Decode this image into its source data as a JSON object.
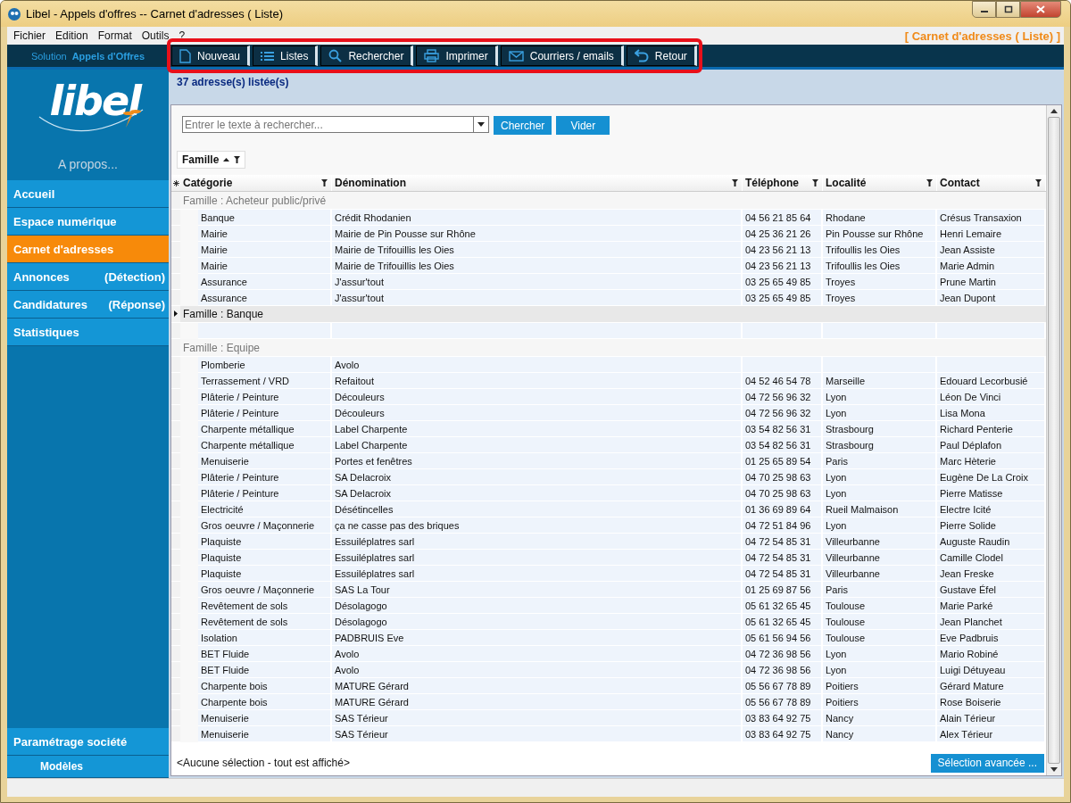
{
  "window": {
    "title": "Libel - Appels d'offres -- Carnet d'adresses ( Liste)"
  },
  "menu": [
    "Fichier",
    "Edition",
    "Format",
    "Outils",
    "?"
  ],
  "screen_label": "[ Carnet d'adresses ( Liste) ]",
  "solution": {
    "prefix": "Solution",
    "name": "Appels d'Offres"
  },
  "toolbar": [
    "Nouveau",
    "Listes",
    "Rechercher",
    "Imprimer",
    "Courriers / emails",
    "Retour"
  ],
  "logo": "libel",
  "about": "A propos...",
  "sidebar": {
    "items": [
      {
        "label": "Accueil",
        "selected": false
      },
      {
        "label": "Espace numérique",
        "selected": false
      },
      {
        "label": "Carnet d'adresses",
        "selected": true
      },
      {
        "label": "Annonces",
        "note": "(Détection)",
        "selected": false
      },
      {
        "label": "Candidatures",
        "note": "(Réponse)",
        "selected": false
      },
      {
        "label": "Statistiques",
        "selected": false
      }
    ],
    "bottom": [
      {
        "label": "Paramétrage société"
      },
      {
        "label": "Modèles"
      }
    ]
  },
  "count": "37 adresse(s) listée(s)",
  "search": {
    "placeholder": "Entrer le texte à rechercher...",
    "buttons": [
      "Chercher",
      "Vider"
    ]
  },
  "group_by": "Famille",
  "table": {
    "columns": [
      "Catégorie",
      "Dénomination",
      "Téléphone",
      "Localité",
      "Contact"
    ],
    "groups": [
      {
        "label": "Famille : Acheteur public/privé",
        "expanded": true,
        "rows": [
          [
            "Banque",
            "Crédit Rhodanien",
            "04 56 21 85 64",
            "Rhodane",
            "Crésus Transaxion"
          ],
          [
            "Mairie",
            "Mairie de Pin Pousse sur Rhône",
            "04 25 36 21 26",
            "Pin Pousse sur Rhône",
            "Henri Lemaire"
          ],
          [
            "Mairie",
            "Mairie de Trifouillis les Oies",
            "04 23 56 21 13",
            "Trifoullis les Oies",
            "Jean Assiste"
          ],
          [
            "Mairie",
            "Mairie de Trifouillis les Oies",
            "04 23 56 21 13",
            "Trifoullis les Oies",
            "Marie Admin"
          ],
          [
            "Assurance",
            "J'assur'tout",
            "03 25 65 49 85",
            "Troyes",
            "Prune Martin"
          ],
          [
            "Assurance",
            "J'assur'tout",
            "03 25 65 49 85",
            "Troyes",
            "Jean Dupont"
          ]
        ]
      },
      {
        "label": "Famille : Banque",
        "expanded": false
      },
      {
        "label": "Famille : Equipe",
        "expanded": true,
        "rows": [
          [
            "Plomberie",
            "Avolo",
            null,
            null,
            null
          ],
          [
            "Terrassement / VRD",
            "Refaitout",
            "04 52 46 54 78",
            "Marseille",
            "Edouard Lecorbusié"
          ],
          [
            "Plâterie / Peinture",
            "Découleurs",
            "04 72 56 96 32",
            "Lyon",
            "Léon De Vinci"
          ],
          [
            "Plâterie / Peinture",
            "Découleurs",
            "04 72 56 96 32",
            "Lyon",
            "Lisa Mona"
          ],
          [
            "Charpente métallique",
            "Label Charpente",
            "03 54 82 56 31",
            "Strasbourg",
            "Richard Penterie"
          ],
          [
            "Charpente métallique",
            "Label Charpente",
            "03 54 82 56 31",
            "Strasbourg",
            "Paul Déplafon"
          ],
          [
            "Menuiserie",
            "Portes et fenêtres",
            "01 25 65 89 54",
            "Paris",
            "Marc Hèterie"
          ],
          [
            "Plâterie / Peinture",
            "SA Delacroix",
            "04 70 25 98 63",
            "Lyon",
            "Eugène De La Croix"
          ],
          [
            "Plâterie / Peinture",
            "SA Delacroix",
            "04 70 25 98 63",
            "Lyon",
            "Pierre Matisse"
          ],
          [
            "Electricité",
            "Désétincelles",
            "01 36 69 89 64",
            "Rueil Malmaison",
            "Electre Icité"
          ],
          [
            "Gros oeuvre / Maçonnerie",
            "ça ne casse pas des briques",
            "04 72 51 84 96",
            "Lyon",
            "Pierre Solide"
          ],
          [
            "Plaquiste",
            "Essuiléplatres sarl",
            "04 72 54 85 31",
            "Villeurbanne",
            "Auguste Raudin"
          ],
          [
            "Plaquiste",
            "Essuiléplatres sarl",
            "04 72 54 85 31",
            "Villeurbanne",
            "Camille Clodel"
          ],
          [
            "Plaquiste",
            "Essuiléplatres sarl",
            "04 72 54 85 31",
            "Villeurbanne",
            "Jean Freske"
          ],
          [
            "Gros oeuvre / Maçonnerie",
            "SAS La Tour",
            "01 25 69 87 56",
            "Paris",
            "Gustave Éfel"
          ],
          [
            "Revêtement de sols",
            "Désolagogo",
            "05 61 32 65 45",
            "Toulouse",
            "Marie Parké"
          ],
          [
            "Revêtement de sols",
            "Désolagogo",
            "05 61 32 65 45",
            "Toulouse",
            "Jean Planchet"
          ],
          [
            "Isolation",
            "PADBRUIS Eve",
            "05 61 56 94 56",
            "Toulouse",
            "Eve Padbruis"
          ],
          [
            "BET Fluide",
            "Avolo",
            "04 72 36 98 56",
            "Lyon",
            "Mario Robiné"
          ],
          [
            "BET Fluide",
            "Avolo",
            "04 72 36 98 56",
            "Lyon",
            "Luigi Détuyeau"
          ],
          [
            "Charpente bois",
            "MATURE Gérard",
            "05 56 67 78 89",
            "Poitiers",
            "Gérard Mature"
          ],
          [
            "Charpente bois",
            "MATURE Gérard",
            "05 56 67 78 89",
            "Poitiers",
            "Rose Boiserie"
          ],
          [
            "Menuiserie",
            "SAS Térieur",
            "03 83 64 92 75",
            "Nancy",
            "Alain Térieur"
          ],
          [
            "Menuiserie",
            "SAS Térieur",
            "03 83 64 92 75",
            "Nancy",
            "Alex Térieur"
          ]
        ]
      }
    ]
  },
  "footer": {
    "selection": "<Aucune sélection - tout est affiché>",
    "button": "Sélection avancée ..."
  }
}
